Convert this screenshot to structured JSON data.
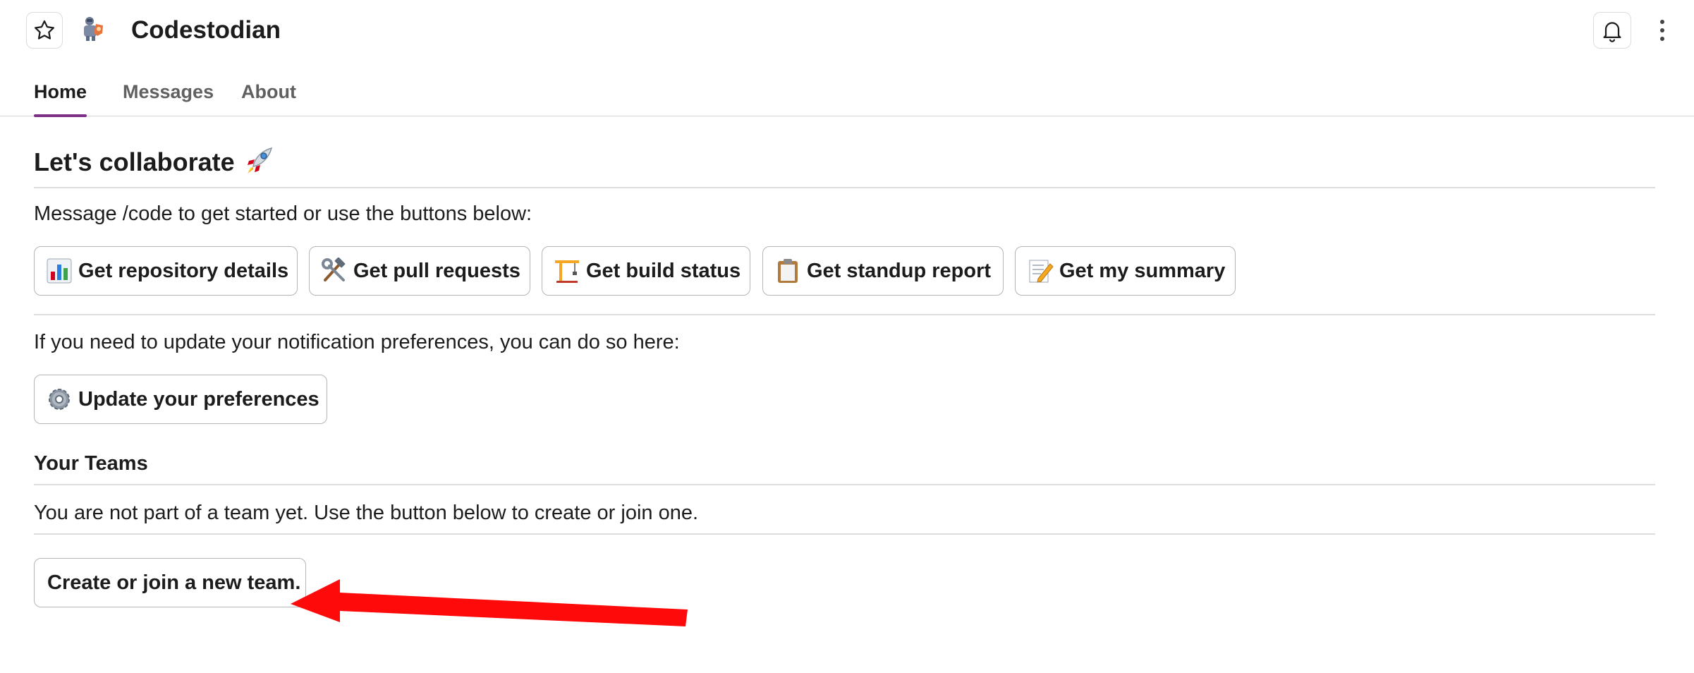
{
  "header": {
    "title": "Codestodian",
    "star_icon": "star-icon",
    "app_icon": "robot-app-icon",
    "bell_icon": "bell-icon",
    "more_icon": "more-vertical-icon"
  },
  "tabs": [
    {
      "label": "Home",
      "active": true
    },
    {
      "label": "Messages",
      "active": false
    },
    {
      "label": "About",
      "active": false
    }
  ],
  "home": {
    "heading": "Let's collaborate",
    "heading_emoji": "rocket-icon",
    "intro": "Message /code to get started or use the buttons below:",
    "actions": [
      {
        "label": "Get repository details",
        "icon": "bar-chart-icon"
      },
      {
        "label": "Get pull requests",
        "icon": "hammer-wrench-icon"
      },
      {
        "label": "Get build status",
        "icon": "construction-crane-icon"
      },
      {
        "label": "Get standup report",
        "icon": "clipboard-icon"
      },
      {
        "label": "Get my summary",
        "icon": "memo-icon"
      }
    ],
    "prefs_text": "If you need to update your notification preferences, you can do so here:",
    "prefs_button": {
      "label": "Update your preferences",
      "icon": "gear-icon"
    },
    "teams_heading": "Your Teams",
    "teams_text": "You are not part of a team yet. Use the button below to create or join one.",
    "team_button": {
      "label": "Create or join a new team."
    }
  },
  "annotation": {
    "arrow_color": "#ff0000",
    "icon": "red-arrow-annotation"
  },
  "colors": {
    "accent": "#7c3085",
    "text": "#1d1c1d",
    "muted": "#616061"
  }
}
